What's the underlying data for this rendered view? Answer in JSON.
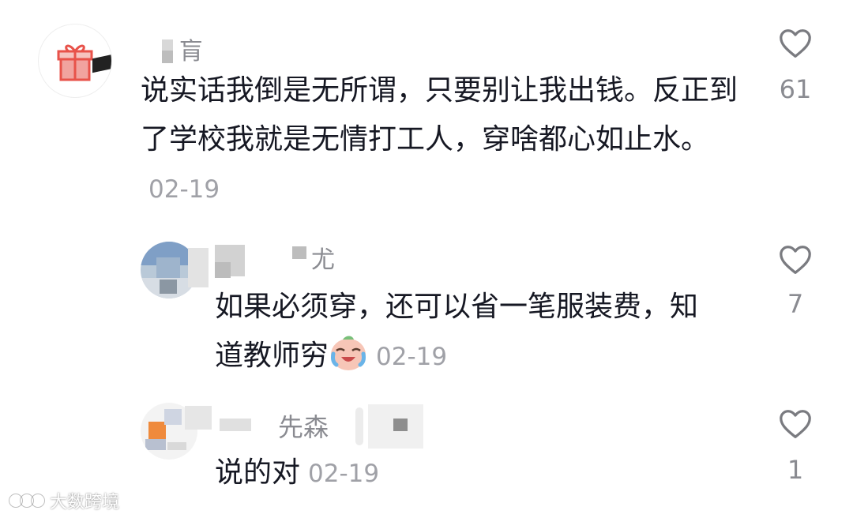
{
  "comments": [
    {
      "username": "肓",
      "text": "说实话我倒是无所谓，只要别让我出钱。反正到了学校我就是无情打工人，穿啥都心如止水。",
      "date": "02-19",
      "likes": "61",
      "avatar_icon": "gift-icon"
    },
    {
      "username": "尤",
      "text": "如果必须穿，还可以省一笔服装费，知道教师穷",
      "emoji": "crying-laughing-emoji",
      "date": "02-19",
      "likes": "7"
    },
    {
      "username": "先森",
      "text": "说的对",
      "date": "02-19",
      "likes": "1"
    }
  ],
  "watermark": "大数跨境",
  "colors": {
    "text": "#161823",
    "secondary": "#8a8b91",
    "date": "#a0a1a7",
    "gift_red": "#e8524a"
  }
}
